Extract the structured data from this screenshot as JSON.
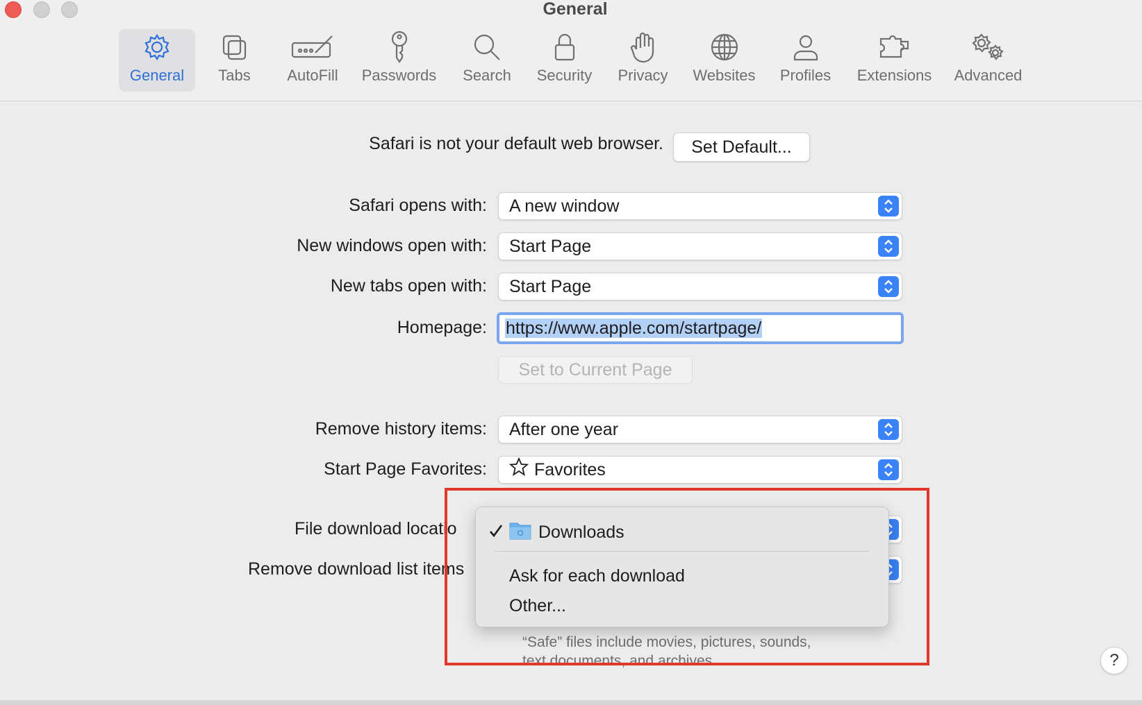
{
  "window": {
    "title": "General"
  },
  "toolbar": {
    "tabs": [
      {
        "label": "General",
        "icon": "gear-icon",
        "active": true
      },
      {
        "label": "Tabs",
        "icon": "tabs-icon"
      },
      {
        "label": "AutoFill",
        "icon": "autofill-icon"
      },
      {
        "label": "Passwords",
        "icon": "key-icon"
      },
      {
        "label": "Search",
        "icon": "search-icon"
      },
      {
        "label": "Security",
        "icon": "lock-icon"
      },
      {
        "label": "Privacy",
        "icon": "hand-icon"
      },
      {
        "label": "Websites",
        "icon": "globe-icon"
      },
      {
        "label": "Profiles",
        "icon": "person-icon"
      },
      {
        "label": "Extensions",
        "icon": "puzzle-icon"
      },
      {
        "label": "Advanced",
        "icon": "gears-icon"
      }
    ]
  },
  "default_browser": {
    "message": "Safari is not your default web browser.",
    "button": "Set Default..."
  },
  "settings": {
    "opens_with": {
      "label": "Safari opens with:",
      "value": "A new window"
    },
    "new_windows": {
      "label": "New windows open with:",
      "value": "Start Page"
    },
    "new_tabs": {
      "label": "New tabs open with:",
      "value": "Start Page"
    },
    "homepage": {
      "label": "Homepage:",
      "value": "https://www.apple.com/startpage/"
    },
    "set_current": {
      "button": "Set to Current Page"
    },
    "remove_history": {
      "label": "Remove history items:",
      "value": "After one year"
    },
    "start_favorites": {
      "label": "Start Page Favorites:",
      "value": "Favorites"
    },
    "download_location": {
      "label": "File download locatio"
    },
    "remove_downloads": {
      "label": "Remove download list items"
    }
  },
  "download_menu": {
    "items": [
      {
        "label": "Downloads",
        "checked": true,
        "icon": "folder-icon"
      },
      {
        "label": "Ask for each download"
      },
      {
        "label": "Other..."
      }
    ]
  },
  "footnote": {
    "line1": "“Safe” files include movies, pictures, sounds,",
    "line2": "text documents, and archives."
  },
  "help": {
    "label": "?"
  },
  "colors": {
    "accent": "#3a82f7",
    "highlight_box": "#e0392b"
  }
}
